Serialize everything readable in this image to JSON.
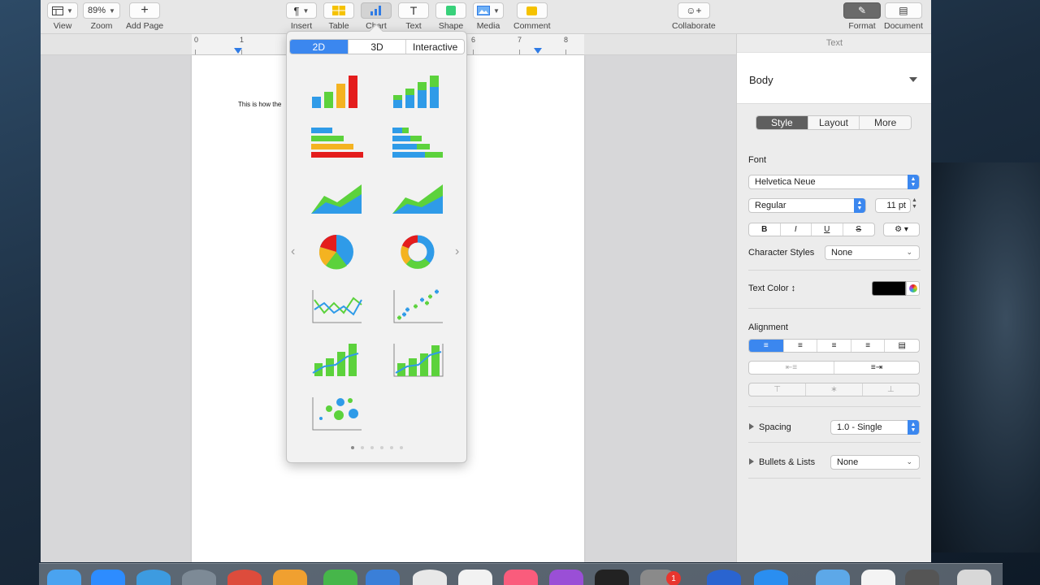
{
  "toolbar": {
    "view_label": "View",
    "zoom_value": "89%",
    "zoom_label": "Zoom",
    "add_page_label": "Add Page",
    "insert_label": "Insert",
    "table_label": "Table",
    "chart_label": "Chart",
    "text_label": "Text",
    "shape_label": "Shape",
    "media_label": "Media",
    "comment_label": "Comment",
    "collaborate_label": "Collaborate",
    "format_label": "Format",
    "document_label": "Document"
  },
  "ruler": {
    "numbers": [
      "0",
      "1",
      "6",
      "7",
      "8"
    ]
  },
  "document": {
    "body_text": "This is how the"
  },
  "chart_popover": {
    "tabs": [
      {
        "label": "2D"
      },
      {
        "label": "3D"
      },
      {
        "label": "Interactive"
      }
    ],
    "selected_tab": "2D",
    "chart_types": [
      "column",
      "stacked-column",
      "bar",
      "stacked-bar",
      "area",
      "stacked-area",
      "pie",
      "donut",
      "line",
      "scatter",
      "mixed",
      "two-axis",
      "bubble"
    ],
    "page_count": 6,
    "current_page": 1
  },
  "sidebar": {
    "header": "Text",
    "paragraph_style": "Body",
    "tabs": [
      {
        "label": "Style"
      },
      {
        "label": "Layout"
      },
      {
        "label": "More"
      }
    ],
    "selected_tab": "Style",
    "font_label": "Font",
    "font_family": "Helvetica Neue",
    "font_style": "Regular",
    "font_size": "11 pt",
    "char_styles_label": "Character Styles",
    "char_styles_value": "None",
    "text_color_label": "Text Color",
    "text_color": "#000000",
    "alignment_label": "Alignment",
    "spacing_label": "Spacing",
    "spacing_value": "1.0 - Single",
    "bullets_label": "Bullets & Lists",
    "bullets_value": "None"
  },
  "dock": {
    "notification_badge": "1"
  },
  "colors": {
    "accent": "#3b87ef",
    "chart_blue": "#2f9be8",
    "chart_green": "#5cd23c",
    "chart_orange": "#f4b321",
    "chart_red": "#e41d1d"
  }
}
